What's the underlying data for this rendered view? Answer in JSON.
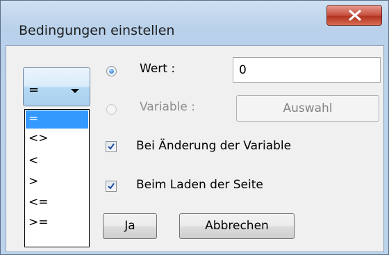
{
  "window": {
    "title": "Bedingungen einstellen"
  },
  "operator": {
    "selected": "=",
    "options": [
      "=",
      "<>",
      "<",
      ">",
      "<=",
      ">="
    ]
  },
  "radios": {
    "wert_label": "Wert :",
    "wert_value": "0",
    "variable_label": "Variable :",
    "auswahl_label": "Auswahl"
  },
  "checks": {
    "change_label": "Bei Änderung der Variable",
    "load_label": "Beim Laden der Seite"
  },
  "buttons": {
    "ok_label": "Ja",
    "cancel_label": "Abbrechen"
  },
  "colors": {
    "selection": "#3399ff",
    "close_button": "#c7503f"
  }
}
